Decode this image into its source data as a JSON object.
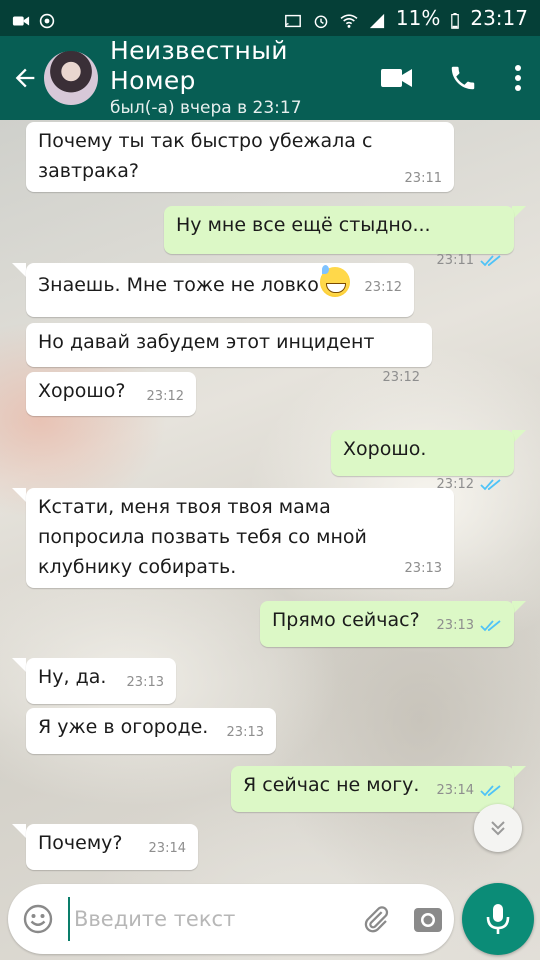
{
  "status_bar": {
    "battery_percent": "11%",
    "time": "23:17"
  },
  "header": {
    "contact_name": "Неизвестный Номер",
    "last_seen": "был(-а) вчера в 23:17"
  },
  "icons": {
    "back": "arrow-left-icon",
    "video": "video-camera-icon",
    "call": "phone-icon",
    "menu": "more-vert-icon",
    "scroll_down": "double-chevron-down-icon",
    "emoji": "smiley-icon",
    "attach": "paperclip-icon",
    "camera": "camera-icon",
    "mic": "microphone-icon"
  },
  "colors": {
    "app_bar": "#075e54",
    "status_bar": "#053f37",
    "outgoing_bubble": "#dcf8c6",
    "incoming_bubble": "#ffffff",
    "read_ticks": "#4fc3f7",
    "send_button": "#0b8c77"
  },
  "messages": [
    {
      "dir": "in",
      "text": "Почему ты так быстро убежала с завтрака?",
      "time": "23:11"
    },
    {
      "dir": "out",
      "text": "Ну мне все ещё стыдно...",
      "time": "23:11",
      "read": true
    },
    {
      "dir": "in",
      "text": "Знаешь. Мне тоже не ловко",
      "time": "23:12",
      "emoji": "grinning-sweat"
    },
    {
      "dir": "in",
      "text": "Но давай забудем этот инцидент",
      "time": "23:12"
    },
    {
      "dir": "in",
      "text": "Хорошо?",
      "time": "23:12"
    },
    {
      "dir": "out",
      "text": "Хорошо.",
      "time": "23:12",
      "read": true
    },
    {
      "dir": "in",
      "text": "Кстати, меня твоя твоя мама попросила позвать тебя со мной клубнику собирать.",
      "time": "23:13"
    },
    {
      "dir": "out",
      "text": "Прямо сейчас?",
      "time": "23:13",
      "read": true
    },
    {
      "dir": "in",
      "text": "Ну, да.",
      "time": "23:13"
    },
    {
      "dir": "in",
      "text": "Я уже в огороде.",
      "time": "23:13"
    },
    {
      "dir": "out",
      "text": "Я сейчас не могу.",
      "time": "23:14",
      "read": true
    },
    {
      "dir": "in",
      "text": "Почему?",
      "time": "23:14"
    }
  ],
  "composer": {
    "placeholder": "Введите текст",
    "value": ""
  }
}
